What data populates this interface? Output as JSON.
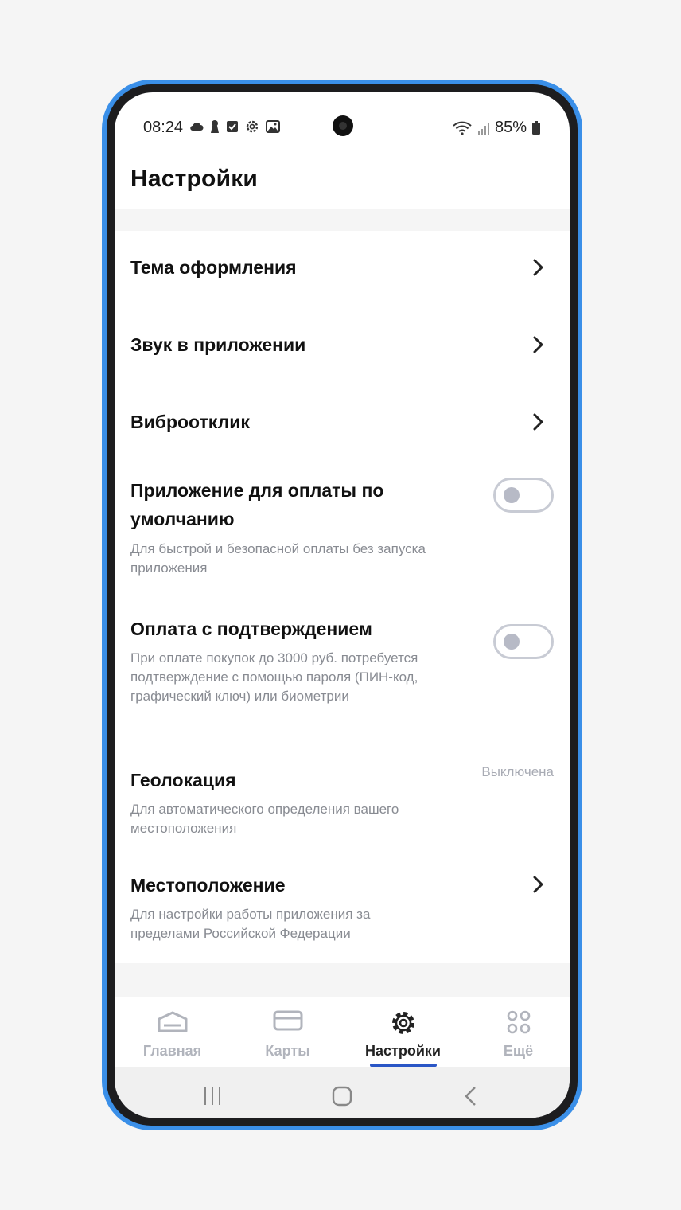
{
  "status": {
    "time": "08:24",
    "battery": "85%"
  },
  "page": {
    "title": "Настройки"
  },
  "settings": [
    {
      "title": "Тема оформления"
    },
    {
      "title": "Звук в приложении"
    },
    {
      "title": "Виброотклик"
    },
    {
      "title": "Приложение для оплаты по умолчанию",
      "subtitle": "Для быстрой и безопасной оплаты без запуска приложения",
      "toggle": false
    },
    {
      "title": "Оплата с подтверждением",
      "subtitle": "При оплате покупок до 3000 руб. потребуется подтверждение с помощью пароля (ПИН-код, графический ключ) или биометрии",
      "toggle": false
    },
    {
      "title": "Геолокация",
      "subtitle": "Для автоматического определения вашего местоположения",
      "value": "Выключена"
    },
    {
      "title": "Местоположение",
      "subtitle": "Для настройки работы приложения за пределами Российской Федерации"
    }
  ],
  "tabs": [
    {
      "label": "Главная",
      "icon": "home-icon",
      "active": false
    },
    {
      "label": "Карты",
      "icon": "card-icon",
      "active": false
    },
    {
      "label": "Настройки",
      "icon": "gear-icon",
      "active": true
    },
    {
      "label": "Ещё",
      "icon": "grid-icon",
      "active": false
    }
  ],
  "colors": {
    "accent": "#2a56c6",
    "frame": "#3a8fe8",
    "muted": "#888b92"
  }
}
